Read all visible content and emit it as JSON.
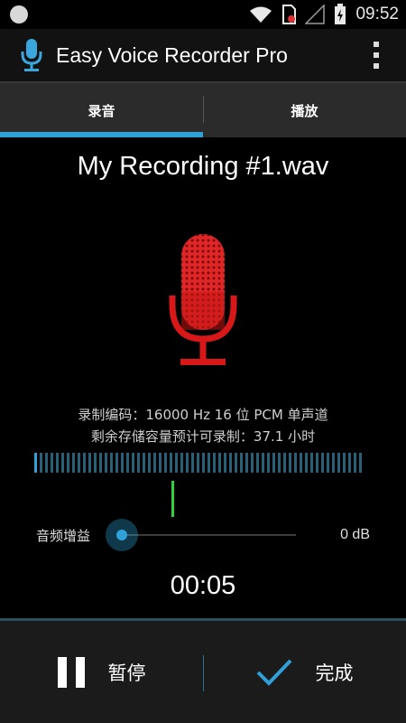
{
  "status_bar": {
    "time": "09:52",
    "icons": [
      "notification-dot-icon",
      "wifi-icon",
      "sim-blocked-icon",
      "signal-icon",
      "battery-icon"
    ]
  },
  "action_bar": {
    "title": "Easy Voice Recorder Pro",
    "icon": "microphone-icon",
    "menu_icon": "overflow-menu-icon"
  },
  "tabs": [
    {
      "label": "录音",
      "selected": true
    },
    {
      "label": "播放",
      "selected": false
    }
  ],
  "recording": {
    "file_name": "My Recording #1.wav",
    "encoding_info": "录制编码：16000 Hz 16 位 PCM 单声道",
    "storage_info": "剩余存储容量预计可录制：37.1 小时",
    "elapsed": "00:05"
  },
  "gain": {
    "label": "音频增益",
    "value_text": "0 dB",
    "slider_fraction": 0.0
  },
  "actions": {
    "pause_label": "暂停",
    "done_label": "完成"
  },
  "colors": {
    "accent": "#2fa0d8",
    "mic_red": "#d81818",
    "level_marker": "#33d13a",
    "tab_bar": "#2b2b2b"
  }
}
